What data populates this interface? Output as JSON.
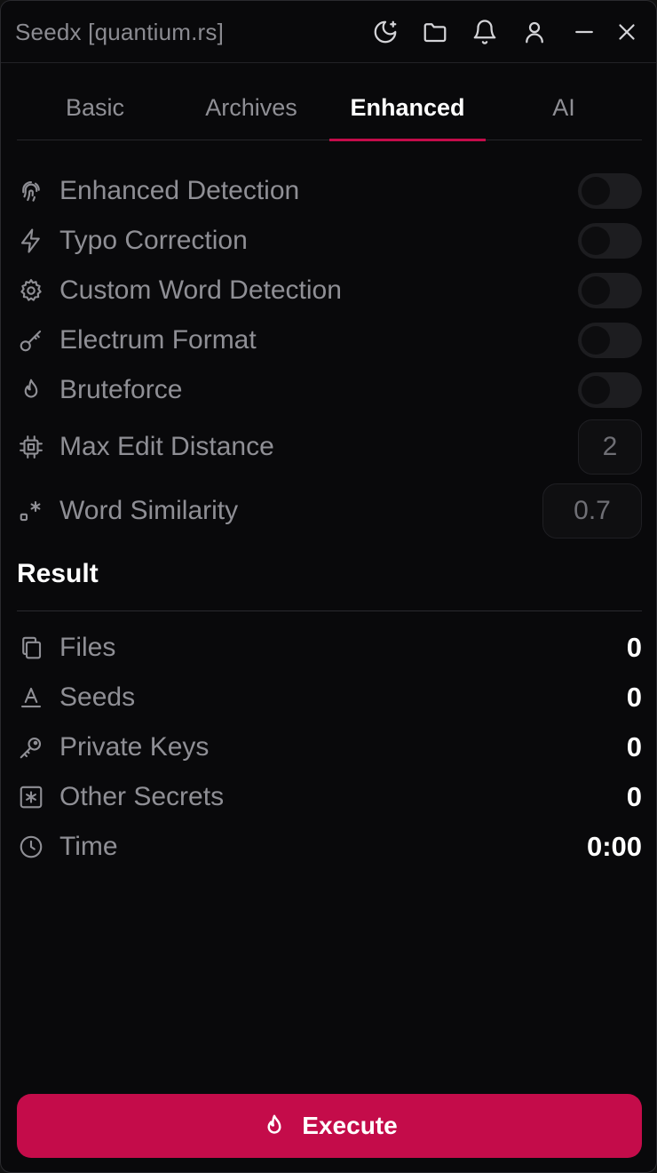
{
  "window": {
    "title": "Seedx [quantium.rs]"
  },
  "titlebar": {
    "buttons": [
      {
        "name": "theme-toggle-button",
        "icon": "moon-sparkle-icon"
      },
      {
        "name": "open-folder-button",
        "icon": "folder-icon"
      },
      {
        "name": "notifications-button",
        "icon": "bell-icon"
      },
      {
        "name": "account-button",
        "icon": "user-icon"
      },
      {
        "name": "minimize-button",
        "icon": "minus-icon"
      },
      {
        "name": "close-button",
        "icon": "close-icon"
      }
    ]
  },
  "tabs": [
    {
      "label": "Basic",
      "active": false
    },
    {
      "label": "Archives",
      "active": false
    },
    {
      "label": "Enhanced",
      "active": true
    },
    {
      "label": "AI",
      "active": false
    }
  ],
  "settings": {
    "enhanced_detection": {
      "label": "Enhanced Detection",
      "icon": "fingerprint-icon",
      "enabled": false
    },
    "typo_correction": {
      "label": "Typo Correction",
      "icon": "lightning-icon",
      "enabled": false
    },
    "custom_word_detection": {
      "label": "Custom Word Detection",
      "icon": "gear-icon",
      "enabled": false
    },
    "electrum_format": {
      "label": "Electrum Format",
      "icon": "key-icon",
      "enabled": false
    },
    "bruteforce": {
      "label": "Bruteforce",
      "icon": "flame-icon",
      "enabled": false
    },
    "max_edit_distance": {
      "label": "Max Edit Distance",
      "icon": "cpu-chip-icon",
      "value": "2"
    },
    "word_similarity": {
      "label": "Word Similarity",
      "icon": "regex-icon",
      "value": "0.7"
    }
  },
  "result": {
    "title": "Result",
    "files": {
      "label": "Files",
      "icon": "copy-files-icon",
      "value": "0"
    },
    "seeds": {
      "label": "Seeds",
      "icon": "text-a-icon",
      "value": "0"
    },
    "private_keys": {
      "label": "Private Keys",
      "icon": "key-round-icon",
      "value": "0"
    },
    "other_secrets": {
      "label": "Other Secrets",
      "icon": "asterisk-square-icon",
      "value": "0"
    },
    "time": {
      "label": "Time",
      "icon": "clock-icon",
      "value": "0:00"
    }
  },
  "execute": {
    "label": "Execute",
    "icon": "flame-icon"
  },
  "colors": {
    "accent": "#c40c4a",
    "background": "#09090b",
    "muted_text": "#8f8f95"
  }
}
